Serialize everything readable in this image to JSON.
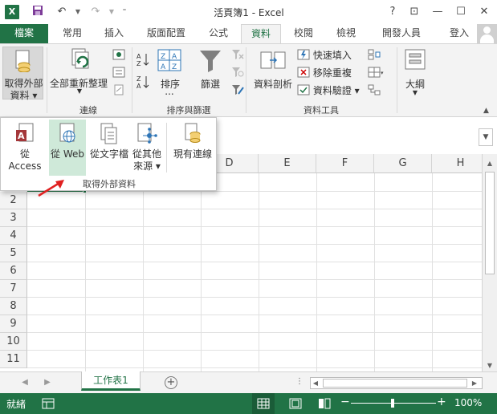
{
  "window": {
    "title": "活頁簿1 - Excel",
    "app_logo": "X",
    "buttons": [
      "?",
      "⊡",
      "—",
      "☐",
      "✕"
    ]
  },
  "tabs": [
    {
      "label": "檔案",
      "active": false
    },
    {
      "label": "常用",
      "active": false
    },
    {
      "label": "插入",
      "active": false
    },
    {
      "label": "版面配置",
      "active": false
    },
    {
      "label": "公式",
      "active": false
    },
    {
      "label": "資料",
      "active": true
    },
    {
      "label": "校閱",
      "active": false
    },
    {
      "label": "檢視",
      "active": false
    },
    {
      "label": "開發人員",
      "active": false
    }
  ],
  "signin": "登入",
  "ribbon": {
    "get_external": {
      "line1": "取得外部",
      "line2": "資料"
    },
    "refresh_all": {
      "label": "全部重新整理"
    },
    "connections_group": "連線",
    "sort_label": "排序",
    "filter_label": "篩選",
    "sort_group_line1": "排序與篩選",
    "sort_more": "...",
    "text_to_columns": "資料剖析",
    "flash_fill": "快速填入",
    "remove_duplicates": "移除重複",
    "data_validation": "資料驗證",
    "data_tools_group": "資料工具",
    "outline": "大綱"
  },
  "dropdown": {
    "items": [
      {
        "label": "從 Access"
      },
      {
        "label": "從 Web"
      },
      {
        "label": "從文字檔"
      },
      {
        "label": "從其他\n來源"
      },
      {
        "label": "現有連線"
      }
    ],
    "group_label": "取得外部資料"
  },
  "grid": {
    "columns": [
      "D",
      "E",
      "F",
      "G",
      "H"
    ],
    "rows": [
      "2",
      "3",
      "4",
      "5",
      "6",
      "7",
      "8",
      "9",
      "10",
      "11"
    ]
  },
  "sheets": [
    {
      "label": "工作表1",
      "active": true
    }
  ],
  "status": {
    "ready": "就緒",
    "zoom_minus": "−",
    "zoom_plus": "+",
    "zoom": "100%"
  },
  "colors": {
    "accent": "#217346",
    "highlight": "#cfe9d9",
    "arrow": "#e02020"
  }
}
